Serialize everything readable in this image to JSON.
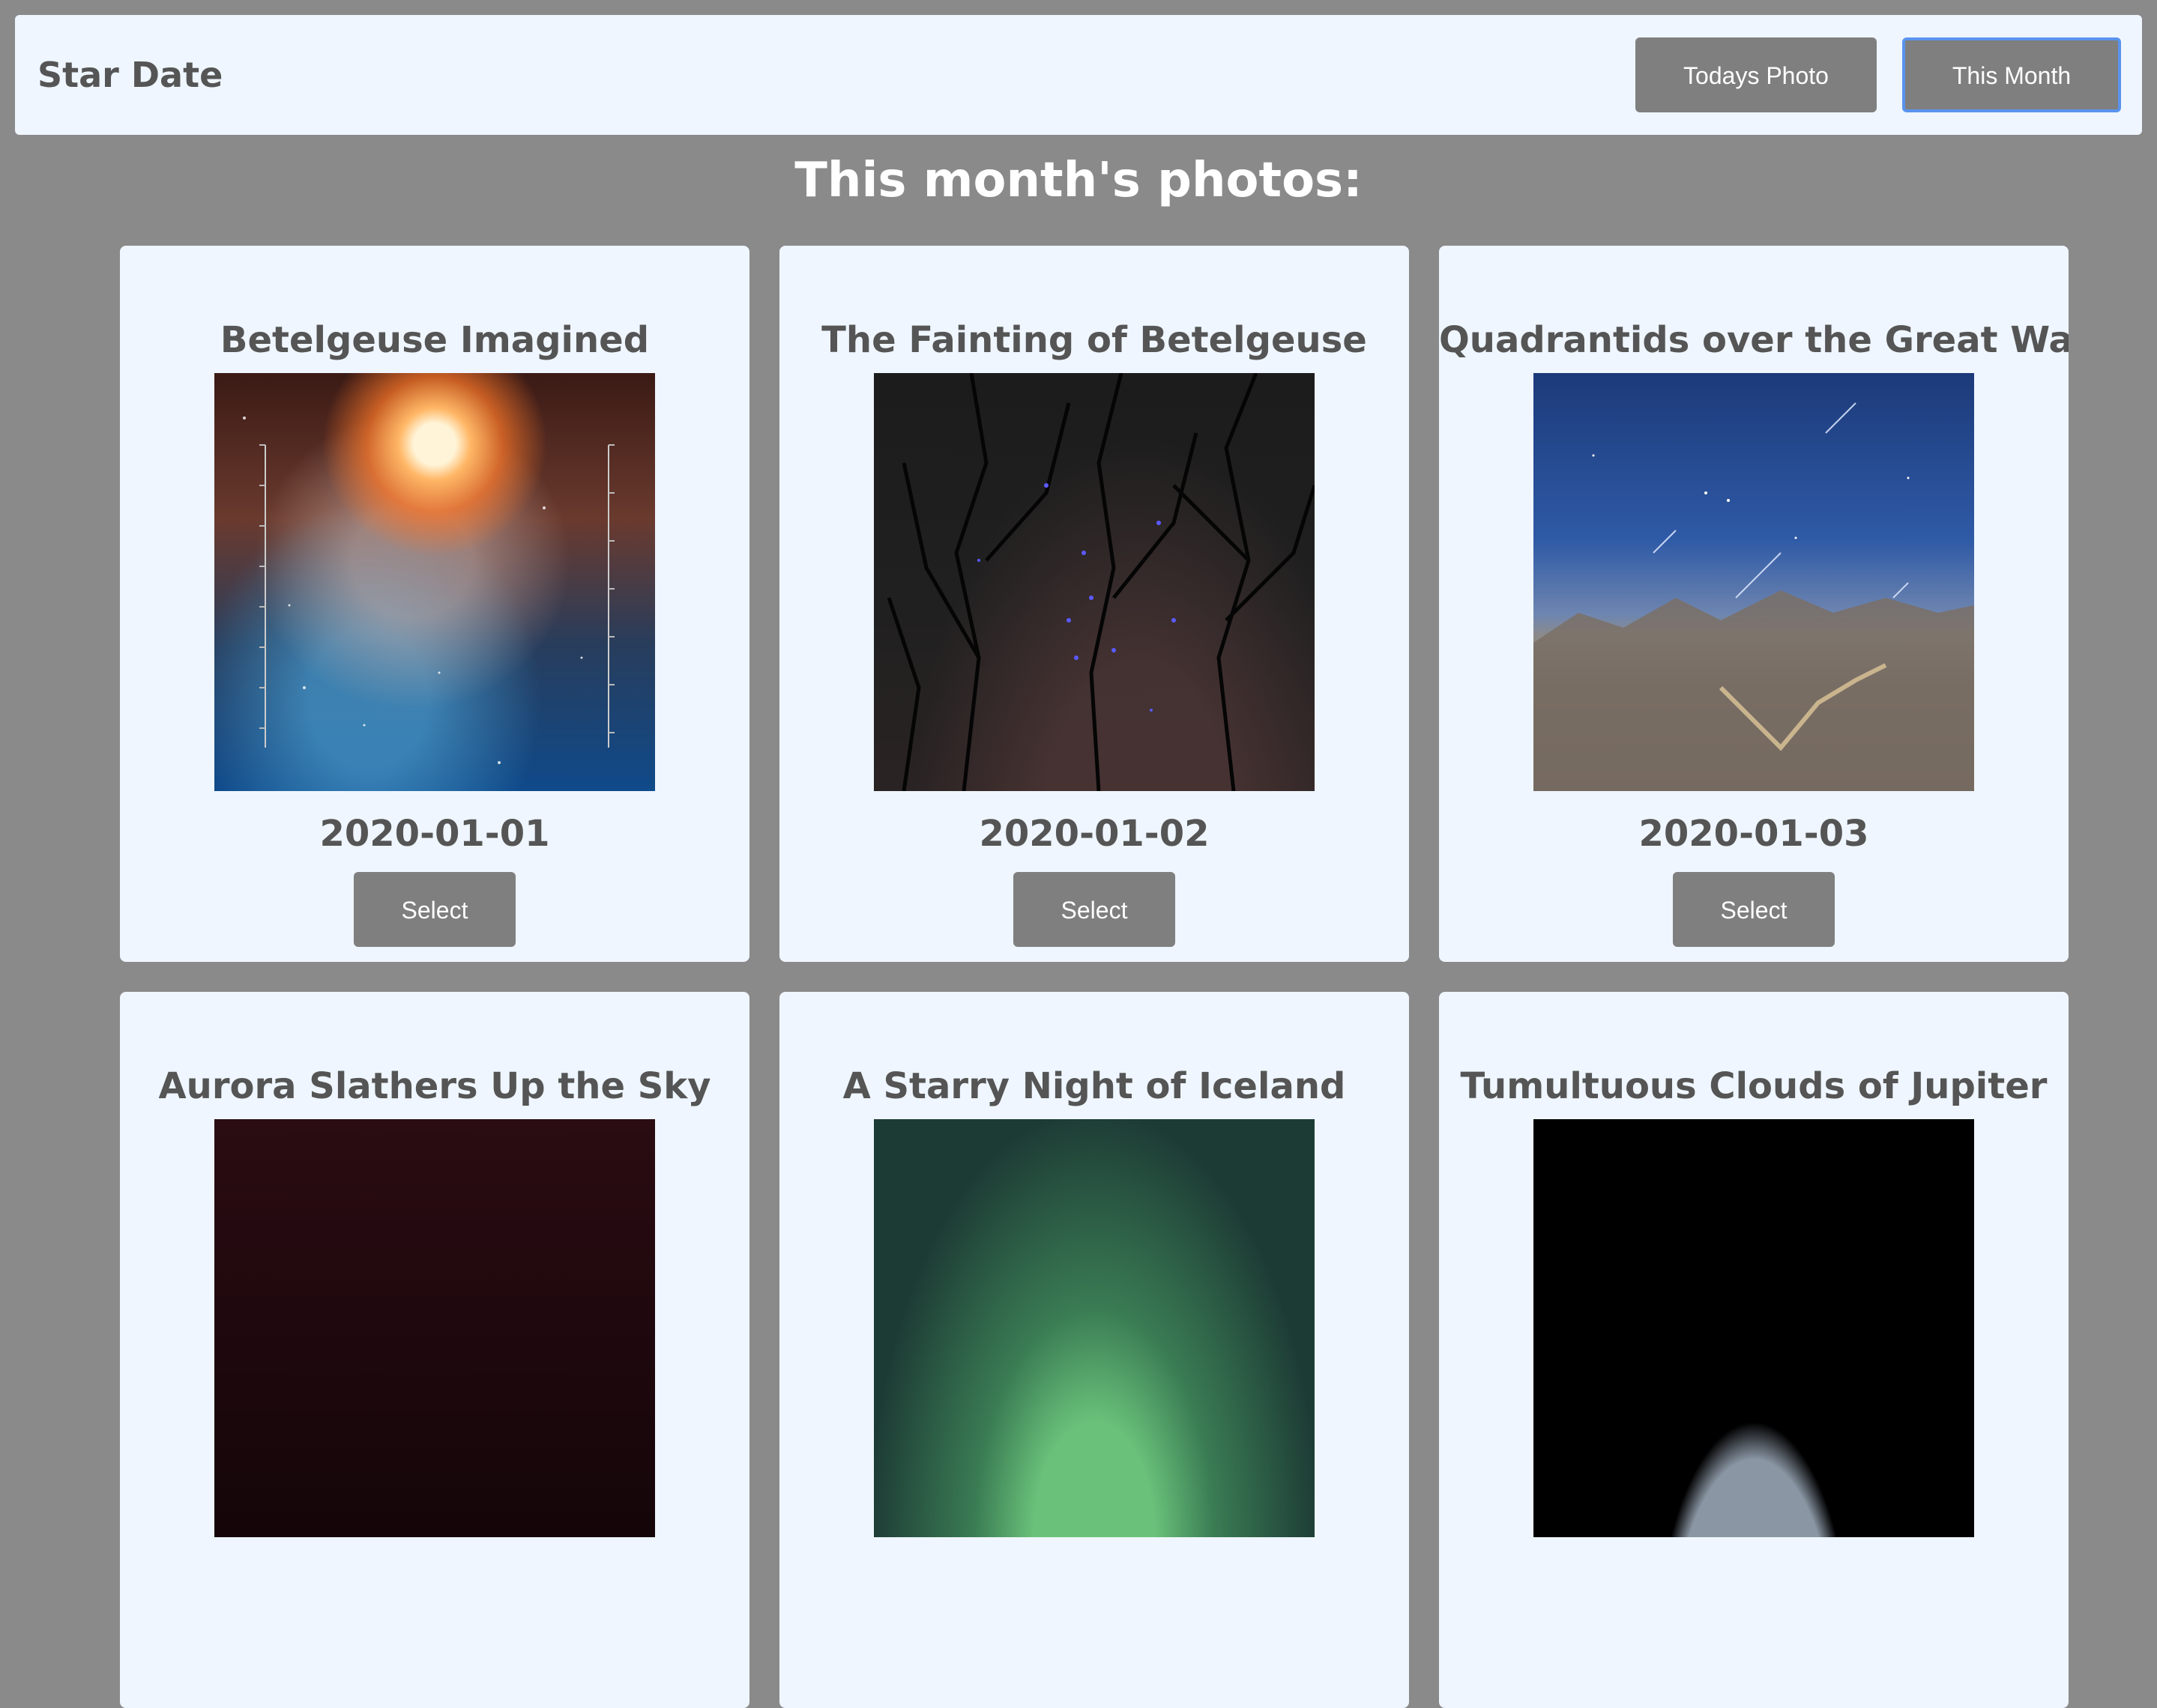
{
  "navbar": {
    "brand": "Star Date",
    "today_label": "Todays Photo",
    "month_label": "This Month"
  },
  "page_title": "This month's photos:",
  "cards": [
    {
      "title": "Betelgeuse Imagined",
      "date": "2020-01-01",
      "select_label": "Select"
    },
    {
      "title": "The Fainting of Betelgeuse",
      "date": "2020-01-02",
      "select_label": "Select"
    },
    {
      "title": "Quadrantids over the Great Wall",
      "date": "2020-01-03",
      "select_label": "Select"
    },
    {
      "title": "Aurora Slathers Up the Sky"
    },
    {
      "title": "A Starry Night of Iceland"
    },
    {
      "title": "Tumultuous Clouds of Jupiter"
    }
  ]
}
